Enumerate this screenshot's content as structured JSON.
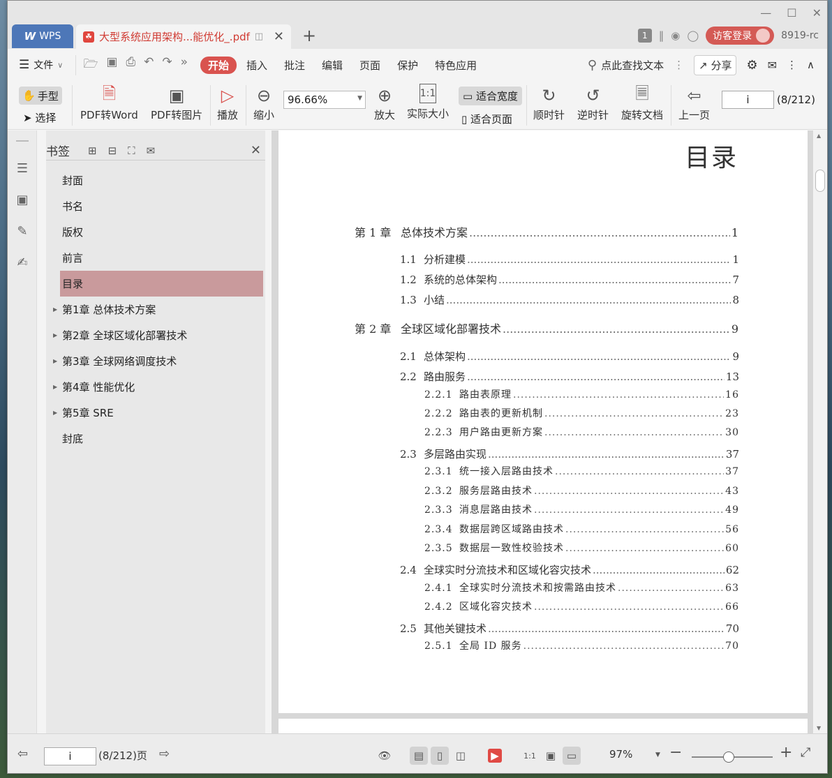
{
  "titlebar": {
    "wps_tab": "WPS",
    "doc_tab": "大型系统应用架构...能优化_.pdf",
    "badge": "1",
    "login": "访客登录",
    "version": "8919-rc"
  },
  "menubar": {
    "file": "文件",
    "items": [
      "开始",
      "插入",
      "批注",
      "编辑",
      "页面",
      "保护",
      "特色应用"
    ],
    "search": "点此查找文本",
    "share": "分享"
  },
  "ribbon": {
    "hand": "手型",
    "select": "选择",
    "pdf_to_word": "PDF转Word",
    "pdf_to_image": "PDF转图片",
    "play": "播放",
    "zoom_out": "缩小",
    "zoom_value": "96.66%",
    "zoom_in": "放大",
    "actual_size": "实际大小",
    "fit_width": "适合宽度",
    "fit_page": "适合页面",
    "clockwise": "顺时针",
    "counterclockwise": "逆时针",
    "rotate_doc": "旋转文档",
    "prev_page": "上一页",
    "page_input": "i",
    "page_count": "(8/212)"
  },
  "bookmarks": {
    "title": "书签",
    "items": [
      {
        "label": "封面",
        "expandable": false
      },
      {
        "label": "书名",
        "expandable": false
      },
      {
        "label": "版权",
        "expandable": false
      },
      {
        "label": "前言",
        "expandable": false
      },
      {
        "label": "目录",
        "expandable": false,
        "selected": true
      },
      {
        "label": "第1章  总体技术方案",
        "expandable": true
      },
      {
        "label": "第2章  全球区域化部署技术",
        "expandable": true
      },
      {
        "label": "第3章  全球网络调度技术",
        "expandable": true
      },
      {
        "label": "第4章  性能优化",
        "expandable": true
      },
      {
        "label": "第5章  SRE",
        "expandable": true
      },
      {
        "label": "封底",
        "expandable": false
      }
    ]
  },
  "page": {
    "title": "目录",
    "toc": [
      {
        "level": 1,
        "num": "第 1 章",
        "text": "总体技术方案",
        "page": "1"
      },
      {
        "level": 2,
        "num": "1.1",
        "text": "分析建模",
        "page": "1"
      },
      {
        "level": 2,
        "num": "1.2",
        "text": "系统的总体架构",
        "page": "7"
      },
      {
        "level": 2,
        "num": "1.3",
        "text": "小结",
        "page": "8"
      },
      {
        "level": 1,
        "num": "第 2 章",
        "text": "全球区域化部署技术",
        "page": "9"
      },
      {
        "level": 2,
        "num": "2.1",
        "text": "总体架构",
        "page": "9"
      },
      {
        "level": 2,
        "num": "2.2",
        "text": "路由服务",
        "page": "13"
      },
      {
        "level": 3,
        "num": "2.2.1",
        "text": "路由表原理",
        "page": "16"
      },
      {
        "level": 3,
        "num": "2.2.2",
        "text": "路由表的更新机制",
        "page": "23"
      },
      {
        "level": 3,
        "num": "2.2.3",
        "text": "用户路由更新方案",
        "page": "30"
      },
      {
        "level": 2,
        "num": "2.3",
        "text": "多层路由实现",
        "page": "37"
      },
      {
        "level": 3,
        "num": "2.3.1",
        "text": "统一接入层路由技术",
        "page": "37"
      },
      {
        "level": 3,
        "num": "2.3.2",
        "text": "服务层路由技术",
        "page": "43"
      },
      {
        "level": 3,
        "num": "2.3.3",
        "text": "消息层路由技术",
        "page": "49"
      },
      {
        "level": 3,
        "num": "2.3.4",
        "text": "数据层跨区域路由技术",
        "page": "56"
      },
      {
        "level": 3,
        "num": "2.3.5",
        "text": "数据层一致性校验技术",
        "page": "60"
      },
      {
        "level": 2,
        "num": "2.4",
        "text": "全球实时分流技术和区域化容灾技术",
        "page": "62"
      },
      {
        "level": 3,
        "num": "2.4.1",
        "text": "全球实时分流技术和按需路由技术",
        "page": "63"
      },
      {
        "level": 3,
        "num": "2.4.2",
        "text": "区域化容灾技术",
        "page": "66"
      },
      {
        "level": 2,
        "num": "2.5",
        "text": "其他关键技术",
        "page": "70"
      },
      {
        "level": 3,
        "num": "2.5.1",
        "text": "全局 ID 服务",
        "page": "70"
      }
    ]
  },
  "statusbar": {
    "page_input": "i",
    "page_count": "(8/212)页",
    "zoom": "97%",
    "zoom_level_percent": 97
  }
}
